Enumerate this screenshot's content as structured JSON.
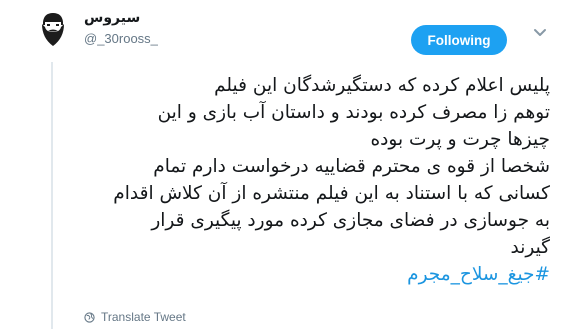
{
  "author": {
    "display_name": "سیروس",
    "screen_name": "@_30rooss_"
  },
  "follow_button": {
    "label": "Following"
  },
  "tweet": {
    "lines": [
      "پلیس اعلام کرده که دستگیرشدگان این فیلم",
      "توهم زا مصرف کرده بودند و داستان آب بازی و این",
      "چیزها چرت و پرت بوده",
      "شخصا از قوه ی محترم قضاییه درخواست دارم تمام",
      "کسانی که با استناد به این فیلم منتشره از آن کلاش اقدام",
      "به جوسازی در فضای مجازی کرده مورد پیگیری قرار",
      "گیرند"
    ],
    "hashtag": "#جیغ_سلاح_مجرم"
  },
  "translate": {
    "label": "Translate Tweet"
  },
  "icons": {
    "avatar": "beard-avatar-icon",
    "chevron": "chevron-down-icon",
    "translate": "globe-icon"
  },
  "colors": {
    "accent": "#1da1f2",
    "link": "#1b95e0",
    "muted": "#657786"
  }
}
